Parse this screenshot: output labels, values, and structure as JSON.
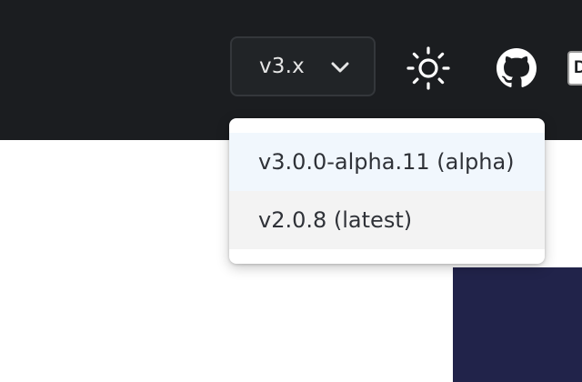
{
  "header": {
    "version_button_label": "v3.x",
    "theme_toggle_icon": "sun-icon",
    "github_icon": "github-icon",
    "edge_button_text": "D"
  },
  "version_menu": {
    "items": [
      {
        "label": "v3.0.0-alpha.11 (alpha)",
        "state": "selected"
      },
      {
        "label": "v2.0.8 (latest)",
        "state": "hover"
      }
    ]
  },
  "colors": {
    "header_bg": "#1b1d20",
    "selected_item_bg": "#f1f7fd",
    "hover_item_bg": "#f3f3f3",
    "content_block": "#21234a"
  }
}
